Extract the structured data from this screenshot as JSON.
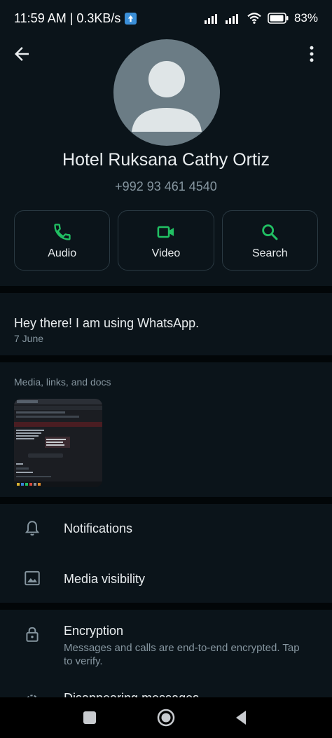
{
  "status_bar": {
    "time_speed": "11:59 AM | 0.3KB/s",
    "battery_percent": "83%"
  },
  "contact": {
    "name": "Hotel Ruksana Cathy Ortiz",
    "phone": "+992 93 461 4540"
  },
  "actions": [
    {
      "label": "Audio",
      "icon": "phone-icon"
    },
    {
      "label": "Video",
      "icon": "video-icon"
    },
    {
      "label": "Search",
      "icon": "search-icon"
    }
  ],
  "about": {
    "text": "Hey there! I am using WhatsApp.",
    "date": "7 June"
  },
  "media": {
    "title": "Media, links, and docs"
  },
  "settings": {
    "notifications": "Notifications",
    "media_visibility": "Media visibility",
    "encryption": "Encryption",
    "encryption_sub": "Messages and calls are end-to-end encrypted. Tap to verify.",
    "disappearing": "Disappearing messages"
  },
  "colors": {
    "background": "#0b141a",
    "accent": "#21c063",
    "secondary_text": "#8696a0"
  }
}
